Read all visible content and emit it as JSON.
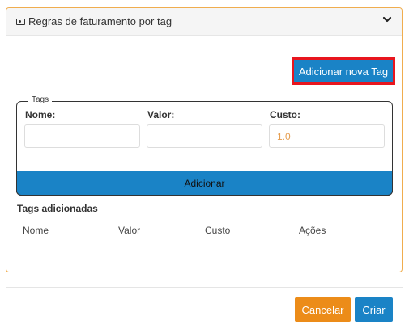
{
  "panel": {
    "title": "Regras de faturamento por tag",
    "header_icon": "money-icon",
    "toggle_icon": "chevron-down-icon",
    "border_color": "#f0ad4e"
  },
  "new_tag_button": {
    "label": "Adicionar nova Tag",
    "highlight_color": "#e8161e"
  },
  "tags_form": {
    "legend": "Tags",
    "name": {
      "label": "Nome:",
      "value": "",
      "placeholder": ""
    },
    "value": {
      "label": "Valor:",
      "value": "",
      "placeholder": ""
    },
    "cost": {
      "label": "Custo:",
      "value": "",
      "placeholder": "1.0"
    },
    "add_button": "Adicionar"
  },
  "tags_added": {
    "title": "Tags adicionadas",
    "columns": [
      "Nome",
      "Valor",
      "Custo",
      "Ações"
    ],
    "rows": []
  },
  "footer": {
    "cancel": "Cancelar",
    "create": "Criar"
  },
  "colors": {
    "primary": "#1a83c6",
    "warning": "#ec8c19"
  }
}
